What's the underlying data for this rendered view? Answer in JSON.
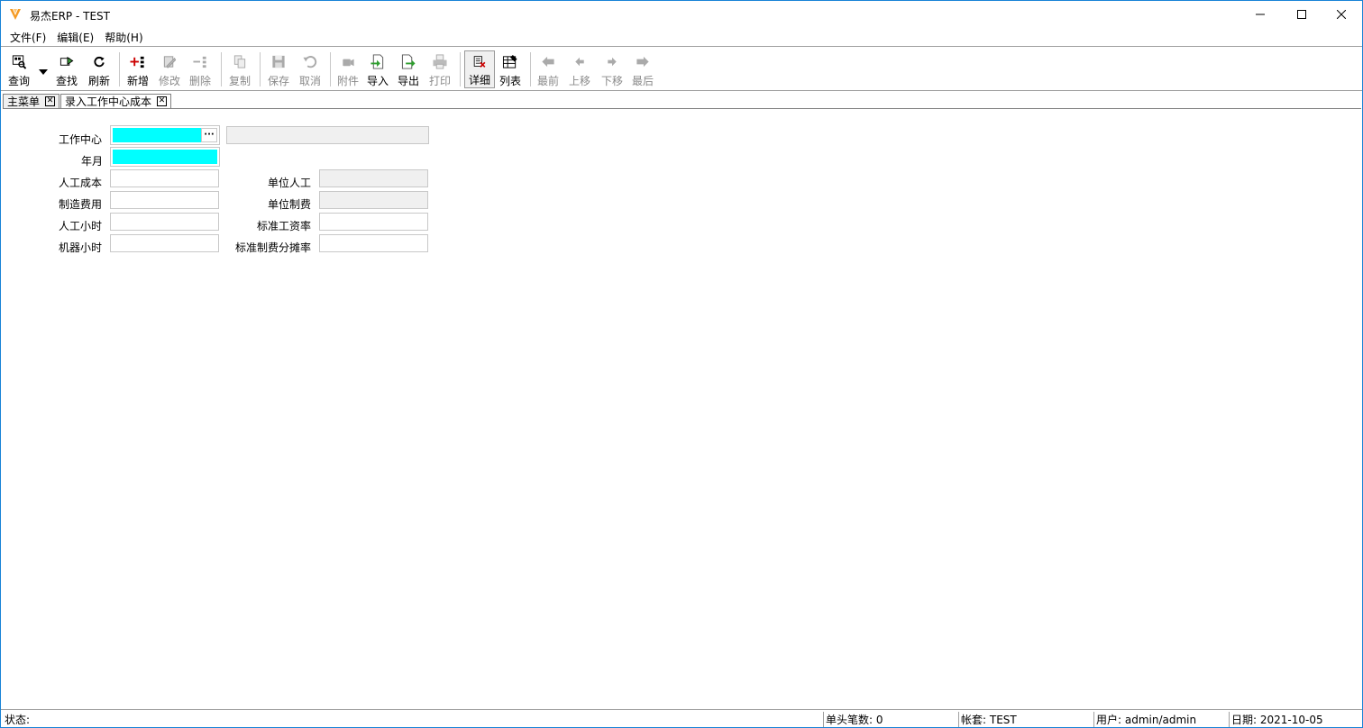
{
  "window": {
    "title": "易杰ERP - TEST",
    "brand_color": "#f59a23"
  },
  "menu": {
    "items": [
      "文件(F)",
      "编辑(E)",
      "帮助(H)"
    ]
  },
  "toolbar": {
    "query": "查询",
    "find": "查找",
    "refresh": "刷新",
    "new": "新增",
    "edit": "修改",
    "delete": "删除",
    "copy": "复制",
    "save": "保存",
    "cancel": "取消",
    "attach": "附件",
    "import": "导入",
    "export": "导出",
    "print": "打印",
    "detail": "详细",
    "list": "列表",
    "first": "最前",
    "prev": "上移",
    "next": "下移",
    "last": "最后"
  },
  "tabs": [
    {
      "label": "主菜单"
    },
    {
      "label": "录入工作中心成本"
    }
  ],
  "form": {
    "work_center": {
      "label": "工作中心",
      "value": "",
      "name_value": ""
    },
    "year_month": {
      "label": "年月",
      "value": ""
    },
    "labor_cost": {
      "label": "人工成本",
      "value": ""
    },
    "unit_labor": {
      "label": "单位人工",
      "value": ""
    },
    "mfg_expense": {
      "label": "制造费用",
      "value": ""
    },
    "unit_mfg": {
      "label": "单位制费",
      "value": ""
    },
    "labor_hours": {
      "label": "人工小时",
      "value": ""
    },
    "std_wage_rate": {
      "label": "标准工资率",
      "value": ""
    },
    "machine_hours": {
      "label": "机器小时",
      "value": ""
    },
    "std_mfg_rate": {
      "label": "标准制费分摊率",
      "value": ""
    },
    "required_color": "#00ffff"
  },
  "statusbar": {
    "status": "状态:",
    "header_count": "单头笔数: 0",
    "account": "帐套: TEST",
    "user": "用户: admin/admin",
    "date": "日期: 2021-10-05"
  }
}
